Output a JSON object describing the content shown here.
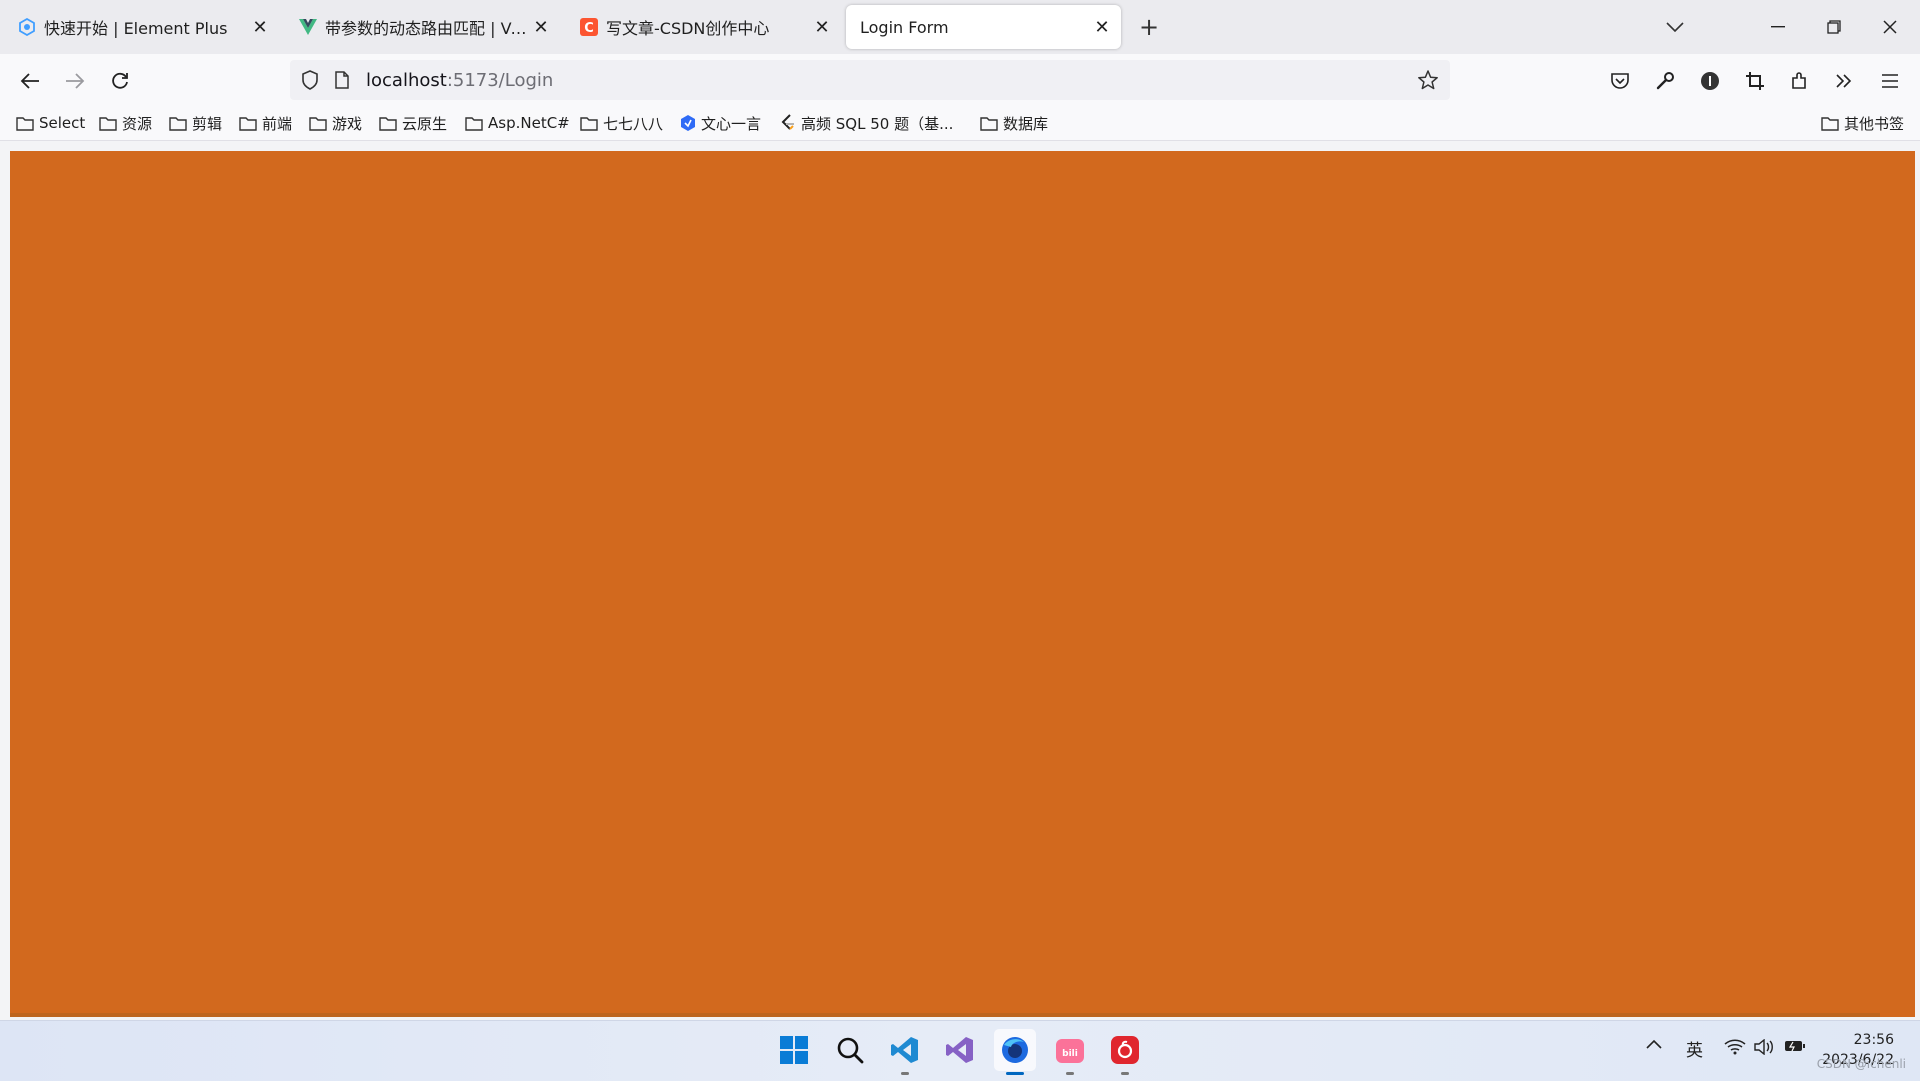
{
  "tabs": [
    {
      "title": "快速开始 | Element Plus",
      "icon": "element-plus-icon",
      "active": false
    },
    {
      "title": "带参数的动态路由匹配 | Vue Router",
      "icon": "vue-icon",
      "active": false
    },
    {
      "title": "写文章-CSDN创作中心",
      "icon": "csdn-icon",
      "active": false
    },
    {
      "title": "Login Form",
      "icon": "",
      "active": true
    }
  ],
  "address": {
    "host": "localhost",
    "rest": ":5173/Login"
  },
  "bookmarks": [
    {
      "label": "Select",
      "icon": "folder-icon"
    },
    {
      "label": "资源",
      "icon": "folder-icon"
    },
    {
      "label": "剪辑",
      "icon": "folder-icon"
    },
    {
      "label": "前端",
      "icon": "folder-icon"
    },
    {
      "label": "游戏",
      "icon": "folder-icon"
    },
    {
      "label": "云原生",
      "icon": "folder-icon"
    },
    {
      "label": "Asp.NetC#",
      "icon": "folder-icon"
    },
    {
      "label": "七七八八",
      "icon": "folder-icon"
    },
    {
      "label": "文心一言",
      "icon": "wenxin-icon"
    },
    {
      "label": "高频 SQL 50 题（基...",
      "icon": "leetcode-icon"
    },
    {
      "label": "数据库",
      "icon": "folder-icon"
    }
  ],
  "other_bookmarks": "其他书签",
  "page": {
    "background": "#d2691e"
  },
  "tray": {
    "ime": "英"
  },
  "clock": {
    "time": "23:56",
    "date": "2023/6/22"
  },
  "watermark": "CSDN @ichenli"
}
